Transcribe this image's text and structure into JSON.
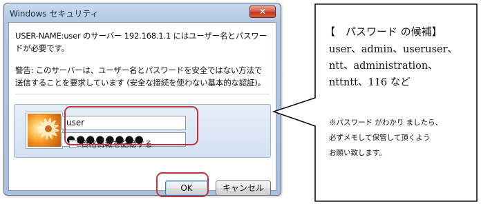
{
  "dialog": {
    "title": "Windows セキュリティ",
    "close_glyph": "✕",
    "message_lines": [
      "USER-NAME:user のサーバー 192.168.1.1 にはユーザー名とパスワー",
      "ドが必要です。"
    ],
    "warning_lines": [
      "警告: このサーバーは、ユーザー名とパスワードを安全ではない方法で",
      "送信することを要求しています (安全な接続を使わない基本的な認証)。"
    ],
    "username_value": "user",
    "password_mask": "●●●●●●●●",
    "remember_label": "資格情報を記憶する",
    "remember_checked": false,
    "ok_label": "OK",
    "cancel_label": "キャンセル",
    "avatar_icon": "user-avatar-flower-icon",
    "highlight_color": "#c0323c"
  },
  "callout": {
    "heading": "【　パスワード の候補】",
    "candidate_lines": [
      "user、admin、useruser、",
      "ntt、administration、",
      "nttntt、116 など"
    ],
    "note_lines": [
      "※パスワード がわかり ましたら、",
      "必ずメモして保管して頂くよう",
      "お願い致します。"
    ]
  }
}
